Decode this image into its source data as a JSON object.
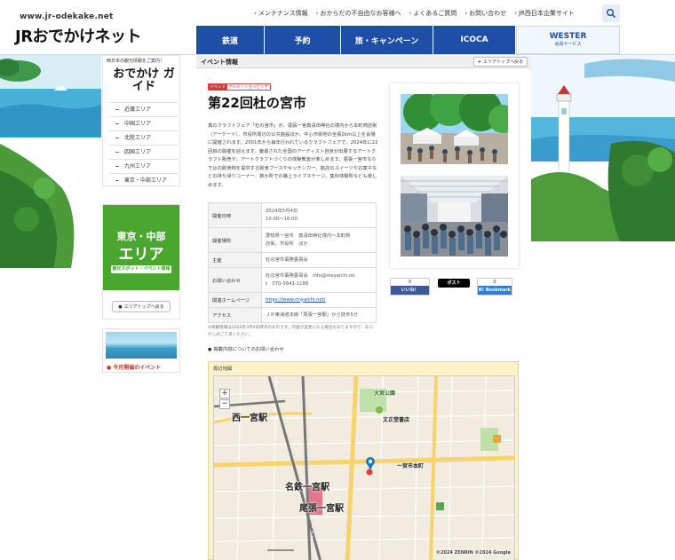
{
  "header": {
    "site_url": "www.jr-odekake.net",
    "logo": "JRおでかけネット",
    "utility_nav": [
      "メンテナンス情報",
      "おからだの不自由なお客様へ",
      "よくあるご質問",
      "お問い合わせ",
      "JR西日本企業サイト"
    ],
    "global_nav": [
      "鉄道",
      "予約",
      "旅・キャンペーン",
      "ICOCA"
    ],
    "wester_label": "WESTER",
    "wester_sub": "会員サービス"
  },
  "sidebar": {
    "guide_tag": "西日本の観光情報をご案内！",
    "guide_title": "おでかけ ガイド",
    "regions": [
      "近畿エリア",
      "中国エリア",
      "北陸エリア",
      "四国エリア",
      "九州エリア",
      "東京・中部エリア"
    ],
    "area_line1": "東京・中部",
    "area_line2": "エリア",
    "area_sub": "観光スポット・イベント情報",
    "area_top_button": "エリアトップへ戻る",
    "event_banner_label": "今月開催のイベント"
  },
  "content": {
    "section_title": "イベント情報",
    "back_button": "エリアトップへ戻る",
    "tag_primary": "イベント",
    "tag_secondary": "グルメ・ショッピング",
    "title": "第22回杜の宮市",
    "intro": "真のクラフトフェア「杜の宮市」が、尾張一宮真清田神社の境内から本町商店街（アーケード）、市役所周辺の公共施設ほか、中心市街地の全長2km以上を会場に開催されます。2001年から毎年行われているクラフトフェアで、2024年に22回目の開催を迎えます。厳選された全国のアーティスト自身が出展するアートクラフト販売や、アートクラフトづくりの体験教室が楽しめます。尾張一宮市ならではの飲食物を提供する飲食ブースやキッチンカー、銘店のスイーツやお菓子などの持ち帰りコーナー、数か所での路上ライブステージ、集科体験所なども楽しめます。",
    "info": [
      {
        "key": "開催日時",
        "lines": [
          "2024年5月4日",
          "10:00～16:00"
        ]
      },
      {
        "key": "開催場所",
        "lines": [
          "愛知県一宮市　真清田神社境内～本町商",
          "店街、市役所　ほか"
        ]
      },
      {
        "key": "主催",
        "lines": [
          "杜の宮市事務委員会"
        ]
      },
      {
        "key": "お問い合わせ",
        "lines": [
          "杜の宮市事務委員会　info@moyaichi.ne",
          "t　070-5641-1188"
        ]
      },
      {
        "key": "関連ホームページ",
        "lines": [
          "https://www.miyaichi.net/"
        ]
      },
      {
        "key": "アクセス",
        "lines": [
          "ＪＲ東海道本線「尾張一宮駅」から徒歩5分"
        ]
      }
    ],
    "note": "※掲載情報は2024年3月9日時点のものです。内容が変更になる場合もありますので、あらかじめご了承ください。",
    "note_link": "掲載内容についてのお問い合わせ"
  },
  "social": {
    "like_count": "0",
    "like_label": "いいね！",
    "post_label": "ポスト",
    "hatena_count": "0",
    "hatena_label": "B! Bookmark"
  },
  "map": {
    "title": "周辺地図",
    "labels": {
      "station_west": "西一宮駅",
      "station_meitetsu": "名鉄一宮駅",
      "station_jr": "尾張一宮駅",
      "park": "大宮公園",
      "school": "文正堂書店",
      "park2": "一宮市本町",
      "copyright": "©2024 ZENRIN ©2024 Google"
    }
  }
}
